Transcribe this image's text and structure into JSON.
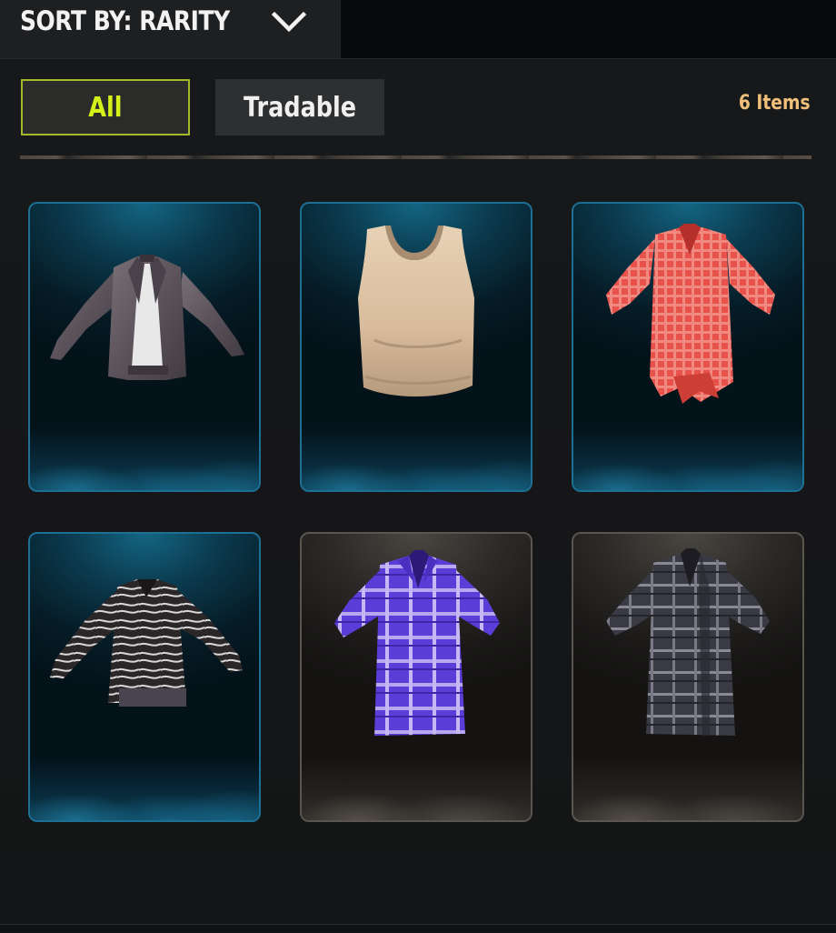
{
  "sort": {
    "label": "SORT BY: RARITY"
  },
  "filters": {
    "all_label": "All",
    "tradable_label": "Tradable"
  },
  "inventory": {
    "count_text": "6 Items"
  },
  "colors": {
    "accent_green": "#d4f21a",
    "count_orange": "#f0c07a",
    "card_blue_border": "#1d6f93",
    "card_gray_border": "#5a554e"
  },
  "items": [
    {
      "icon": "leather-jacket-icon",
      "rarity_color": "blue"
    },
    {
      "icon": "tank-top-icon",
      "rarity_color": "blue"
    },
    {
      "icon": "red-plaid-shirt-icon",
      "rarity_color": "blue"
    },
    {
      "icon": "topographic-jacket-icon",
      "rarity_color": "blue"
    },
    {
      "icon": "purple-plaid-shirt-icon",
      "rarity_color": "gray"
    },
    {
      "icon": "gray-plaid-shirt-icon",
      "rarity_color": "gray"
    }
  ]
}
